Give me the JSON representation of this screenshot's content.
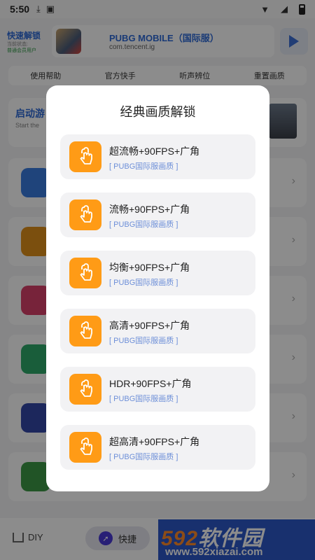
{
  "status_bar": {
    "time": "5:50"
  },
  "header": {
    "brand_title": "快速解锁",
    "brand_sub1": "当前状态:",
    "brand_sub2": "普通会员用户",
    "app_name": "PUBG MOBILE（国际服）",
    "app_package": "com.tencent.ig"
  },
  "quick_links": [
    "使用帮助",
    "官方快手",
    "听声辨位",
    "重置画质"
  ],
  "banner": {
    "title": "启动游",
    "subtitle": "Start the"
  },
  "list_icon_colors": [
    "#3a7de0",
    "#e0901a",
    "#d9406b",
    "#2faa6a",
    "#3347a8",
    "#3d9a45"
  ],
  "dialog": {
    "title": "经典画质解锁",
    "options": [
      {
        "title": "超流畅+90FPS+广角",
        "subtitle": "[ PUBG国际服画质 ]"
      },
      {
        "title": "流畅+90FPS+广角",
        "subtitle": "[ PUBG国际服画质 ]"
      },
      {
        "title": "均衡+90FPS+广角",
        "subtitle": "[ PUBG国际服画质 ]"
      },
      {
        "title": "高清+90FPS+广角",
        "subtitle": "[ PUBG国际服画质 ]"
      },
      {
        "title": "HDR+90FPS+广角",
        "subtitle": "[ PUBG国际服画质 ]"
      },
      {
        "title": "超高清+90FPS+广角",
        "subtitle": "[ PUBG国际服画质 ]"
      }
    ]
  },
  "bottom_nav": {
    "diy_label": "DIY",
    "quick_label": "快捷"
  },
  "watermark": {
    "brand_num": "592",
    "brand_text": "软件园",
    "url": "www.592xiazai.com"
  }
}
